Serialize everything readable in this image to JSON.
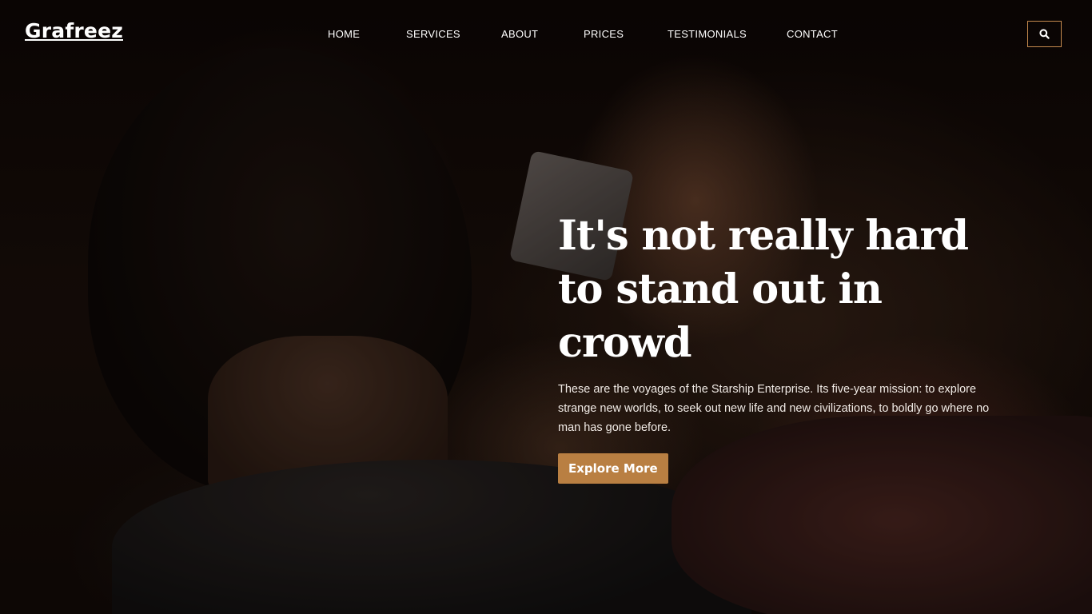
{
  "brand": {
    "logo_text": "Grafreez"
  },
  "nav": {
    "items": [
      {
        "label": "HOME"
      },
      {
        "label": "SERVICES"
      },
      {
        "label": "ABOUT"
      },
      {
        "label": "PRICES"
      },
      {
        "label": "TESTIMONIALS"
      },
      {
        "label": "CONTACT"
      }
    ],
    "search_icon": "search-icon"
  },
  "hero": {
    "background_image": "barber-trimming-client-neck",
    "title": "It's not really hard to stand out in crowd",
    "description": "These are the voyages of the Starship Enterprise. Its five-year mission: to explore strange new worlds, to seek out new life and new civilizations, to boldly go where no man has gone before.",
    "cta_label": "Explore More"
  },
  "colors": {
    "accent": "#b97f42",
    "search_border": "#c58a4e",
    "text": "#ffffff"
  }
}
